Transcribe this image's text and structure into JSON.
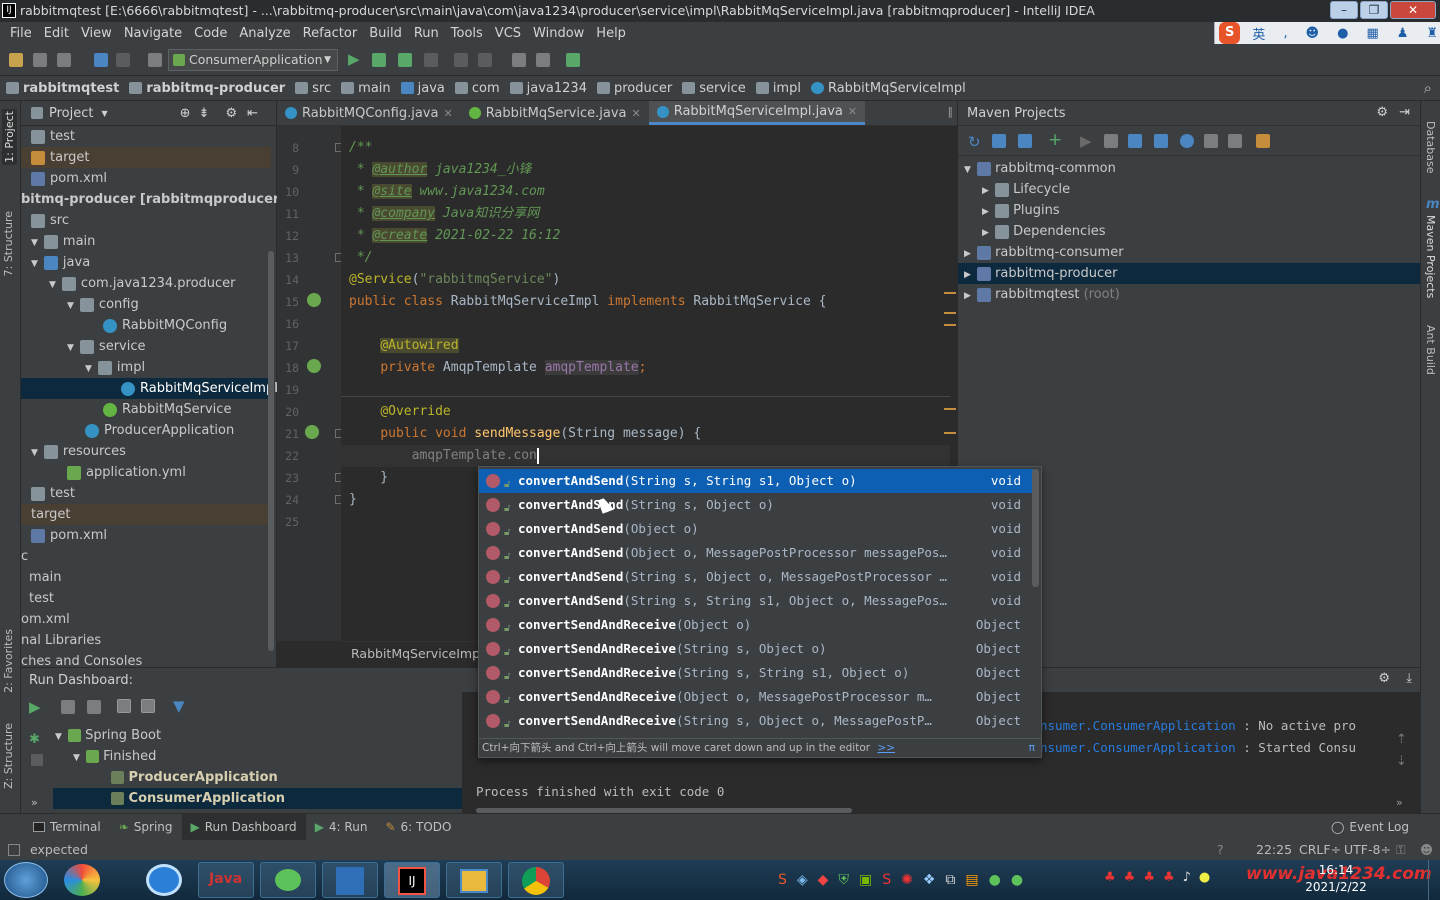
{
  "window": {
    "title": "rabbitmqtest [E:\\6666\\rabbitmqtest] - ...\\rabbitmq-producer\\src\\main\\java\\com\\java1234\\producer\\service\\impl\\RabbitMqServiceImpl.java [rabbitmqproducer] - IntelliJ IDEA"
  },
  "menu": [
    "File",
    "Edit",
    "View",
    "Navigate",
    "Code",
    "Analyze",
    "Refactor",
    "Build",
    "Run",
    "Tools",
    "VCS",
    "Window",
    "Help"
  ],
  "toolbar": {
    "run_config": "ConsumerApplication"
  },
  "ime": {
    "label": "英"
  },
  "breadcrumbs": [
    "rabbitmqtest",
    "rabbitmq-producer",
    "src",
    "main",
    "java",
    "com",
    "java1234",
    "producer",
    "service",
    "impl",
    "RabbitMqServiceImpl"
  ],
  "project": {
    "title": "Project",
    "rows": [
      "test",
      "target",
      "pom.xml",
      "bitmq-producer [rabbitmqproducer]",
      "src",
      "main",
      "java",
      "com.java1234.producer",
      "config",
      "RabbitMQConfig",
      "service",
      "impl",
      "RabbitMqServiceImpl",
      "RabbitMqService",
      "ProducerApplication",
      "resources",
      "application.yml",
      "test",
      "target",
      "pom.xml",
      "c",
      "main",
      "test",
      "om.xml",
      "nal Libraries",
      "ches and Consoles"
    ]
  },
  "editor_tabs": [
    "RabbitMQConfig.java",
    "RabbitMqService.java",
    "RabbitMqServiceImpl.java"
  ],
  "code": {
    "line_numbers": [
      "8",
      "9",
      "10",
      "11",
      "12",
      "13",
      "14",
      "15",
      "16",
      "17",
      "18",
      "19",
      "20",
      "21",
      "22",
      "23",
      "24",
      "25"
    ],
    "author_tag": "@author",
    "author_val": " java1234_小锋",
    "site_tag": "@site",
    "site_val": " www.java1234.com",
    "company_tag": "@company",
    "company_val": " Java知识分享网",
    "create_tag": "@create",
    "create_val": " 2021-02-22 16:12",
    "service_ann": "@Service",
    "service_arg": "\"rabbitmqService\"",
    "class_kw": "public class",
    "class_name": " RabbitMqServiceImpl ",
    "impl_kw": "implements",
    "iface": " RabbitMqService {",
    "autowired": "@Autowired",
    "private_kw": "private",
    "field_type": " AmqpTemplate ",
    "field_name": "amqpTemplate",
    "override": "@Override",
    "method_kw": "public void",
    "method_name": "sendMessage",
    "method_params": "(String message) {",
    "typing": "amqpTemplate.con",
    "footer_crumb": "RabbitMqServiceImpl"
  },
  "completion": {
    "items": [
      {
        "bold": "convertAndSend",
        "rest": "(String s, String s1, Object o)",
        "type": "void"
      },
      {
        "bold": "convertAndSend",
        "rest": "(String s, Object o)",
        "type": "void"
      },
      {
        "bold": "convertAndSend",
        "rest": "(Object o)",
        "type": "void"
      },
      {
        "bold": "convertAndSend",
        "rest": "(Object o, MessagePostProcessor messagePos…",
        "type": "void"
      },
      {
        "bold": "convertAndSend",
        "rest": "(String s, Object o, MessagePostProcessor …",
        "type": "void"
      },
      {
        "bold": "convertAndSend",
        "rest": "(String s, String s1, Object o, MessagePos…",
        "type": "void"
      },
      {
        "bold": "convertSendAndReceive",
        "rest": "(Object o)",
        "type": "Object"
      },
      {
        "bold": "convertSendAndReceive",
        "rest": "(String s, Object o)",
        "type": "Object"
      },
      {
        "bold": "convertSendAndReceive",
        "rest": "(String s, String s1, Object o)",
        "type": "Object"
      },
      {
        "bold": "convertSendAndReceive",
        "rest": "(Object o, MessagePostProcessor m…",
        "type": "Object"
      },
      {
        "bold": "convertSendAndReceive",
        "rest": "(String s, Object o, MessagePostP…",
        "type": "Object"
      }
    ],
    "footer": "Ctrl+向下箭头 and Ctrl+向上箭头 will move caret down and up in the editor",
    "footer_link": ">>"
  },
  "maven": {
    "title": "Maven Projects",
    "rows": [
      {
        "label": "rabbitmq-common",
        "extra": ""
      },
      {
        "label": "Lifecycle",
        "extra": ""
      },
      {
        "label": "Plugins",
        "extra": ""
      },
      {
        "label": "Dependencies",
        "extra": ""
      },
      {
        "label": "rabbitmq-consumer",
        "extra": ""
      },
      {
        "label": "rabbitmq-producer",
        "extra": ""
      },
      {
        "label": "rabbitmqtest",
        "extra": " (root)"
      }
    ]
  },
  "right_strip": [
    "Database",
    "Maven Projects",
    "Ant Build"
  ],
  "left_strip": [
    "1: Project",
    "7: Structure",
    "2: Favorites",
    "Z: Structure"
  ],
  "run": {
    "title": "Run Dashboard:",
    "tree": [
      "Spring Boot",
      "Finished",
      "ProducerApplication",
      "ConsumerApplication"
    ],
    "console": [
      {
        "cls": "nsumer.ConsumerApplication",
        "msg": " : No active pro"
      },
      {
        "cls": "nsumer.ConsumerApplication",
        "msg": " : Started Consu"
      }
    ],
    "exit": "Process finished with exit code 0"
  },
  "tool_tabs": [
    "Terminal",
    "Spring",
    "Run Dashboard",
    "4: Run",
    "6: TODO"
  ],
  "event_log": "Event Log",
  "status": {
    "message": "expected",
    "position": "22:25",
    "line_sep": "CRLF÷",
    "encoding": "UTF-8÷"
  },
  "taskbar": {
    "time": "16:14",
    "date": "2021/2/22",
    "watermark": "www.java1234.com",
    "app_java": "Java"
  }
}
